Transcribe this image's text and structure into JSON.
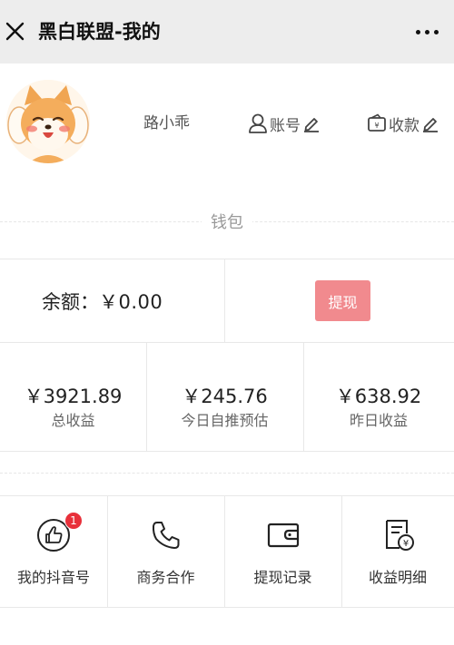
{
  "header": {
    "title": "黑白联盟-我的",
    "close_icon": "close-icon",
    "more_icon": "more-dots-icon"
  },
  "profile": {
    "avatar_icon": "shiba-dog-avatar",
    "username": "路小乖",
    "account_label": "账号",
    "collect_label": "收款"
  },
  "wallet": {
    "title": "钱包",
    "balance_label": "余额：",
    "balance_value": "￥0.00",
    "withdraw_label": "提现"
  },
  "stats": [
    {
      "value": "￥3921.89",
      "label": "总收益"
    },
    {
      "value": "￥245.76",
      "label": "今日自推预估"
    },
    {
      "value": "￥638.92",
      "label": "昨日收益"
    }
  ],
  "menu": [
    {
      "label": "我的抖音号",
      "icon": "thumbs-up-icon",
      "badge": "1"
    },
    {
      "label": "商务合作",
      "icon": "phone-icon"
    },
    {
      "label": "提现记录",
      "icon": "wallet-icon"
    },
    {
      "label": "收益明细",
      "icon": "bill-icon"
    }
  ],
  "colors": {
    "header_bg": "#ededed",
    "withdraw_button": "#f18a8e",
    "badge": "#e8303a"
  }
}
